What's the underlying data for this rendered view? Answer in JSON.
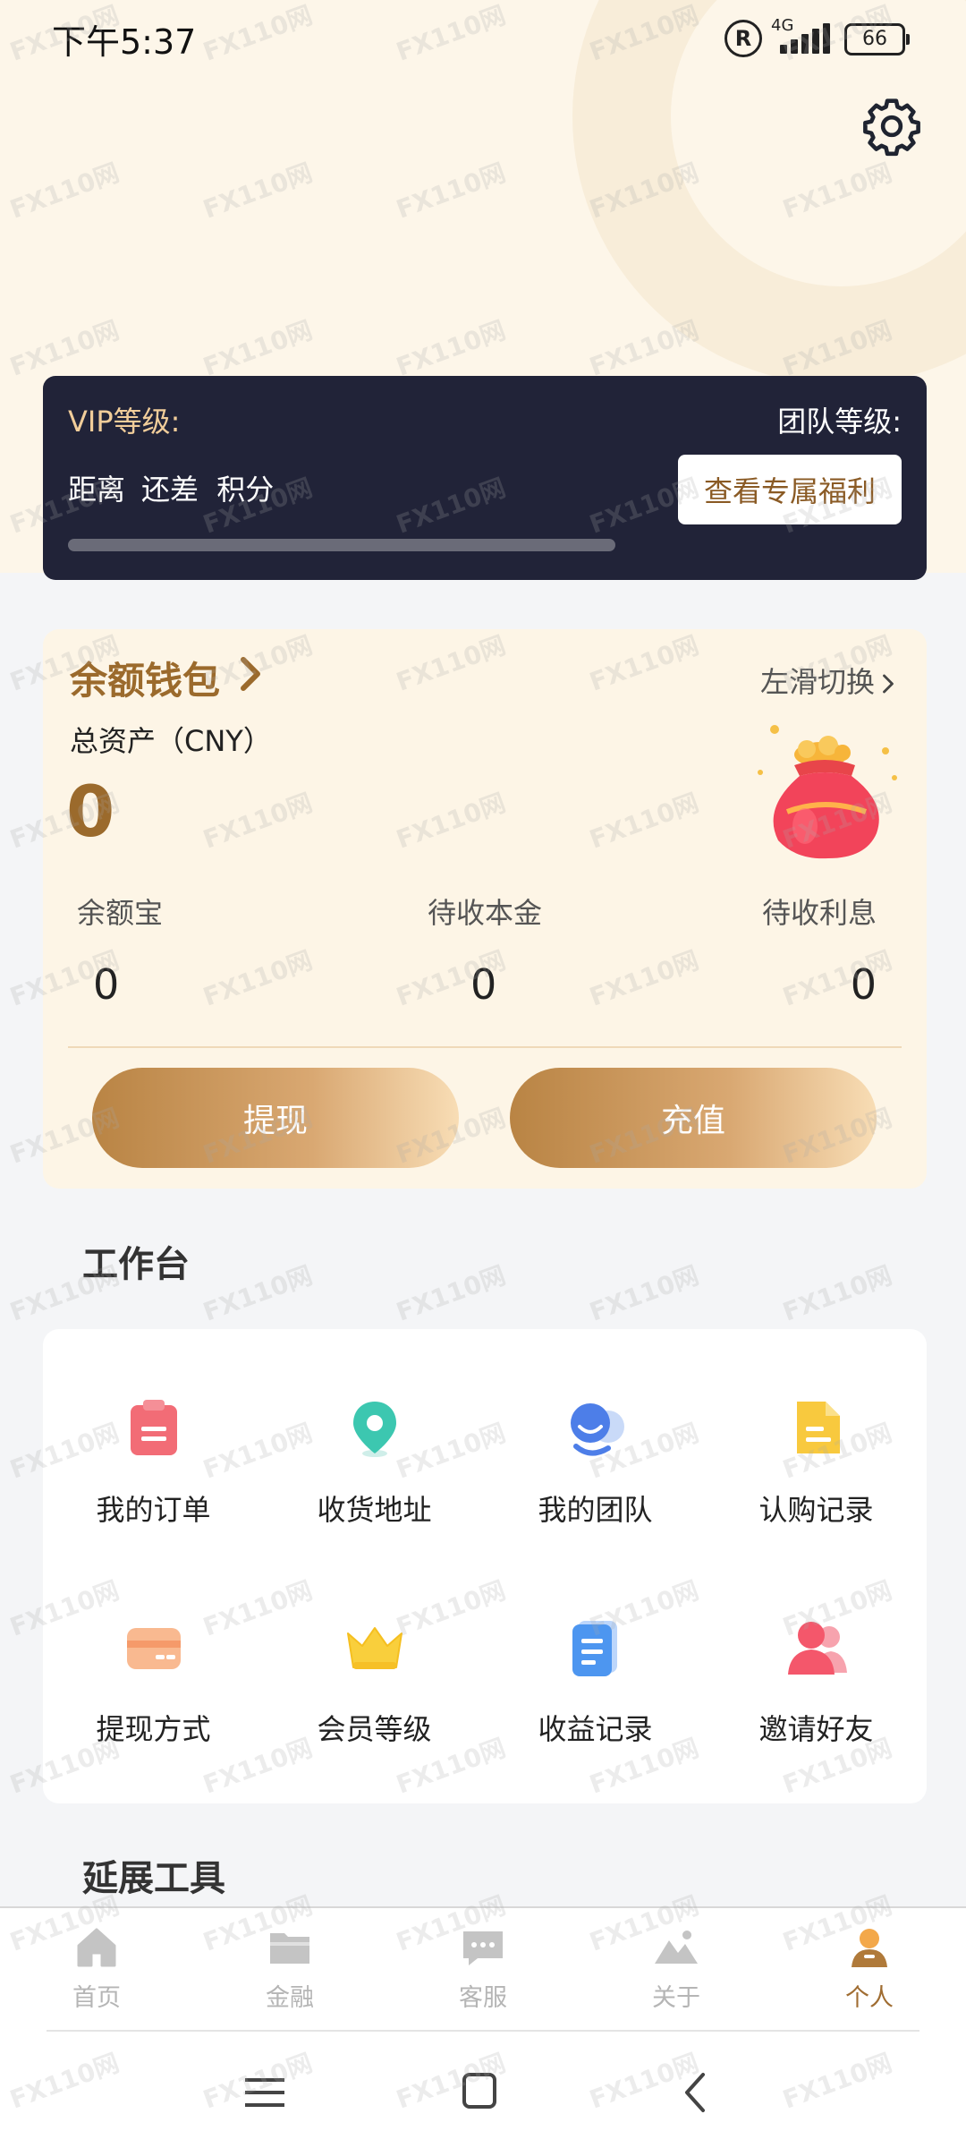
{
  "status_bar": {
    "time": "下午5:37",
    "network": "4G",
    "battery": "66"
  },
  "vip_card": {
    "vip_level_label": "VIP等级:",
    "team_level_label": "团队等级:",
    "distance_words": [
      "距离",
      "还差",
      "积分"
    ],
    "benefit_button": "查看专属福利"
  },
  "wallet": {
    "title": "余额钱包",
    "swipe_hint": "左滑切换",
    "total_assets_label": "总资产（CNY）",
    "total_assets_value": "0",
    "stats": [
      {
        "label": "余额宝",
        "value": "0"
      },
      {
        "label": "待收本金",
        "value": "0"
      },
      {
        "label": "待收利息",
        "value": "0"
      }
    ],
    "withdraw_button": "提现",
    "recharge_button": "充值"
  },
  "workbench": {
    "title": "工作台",
    "items": [
      {
        "label": "我的订单",
        "icon": "order-icon"
      },
      {
        "label": "收货地址",
        "icon": "location-pin-icon"
      },
      {
        "label": "我的团队",
        "icon": "team-icon"
      },
      {
        "label": "认购记录",
        "icon": "subscription-record-icon"
      },
      {
        "label": "提现方式",
        "icon": "card-icon"
      },
      {
        "label": "会员等级",
        "icon": "crown-icon"
      },
      {
        "label": "收益记录",
        "icon": "earnings-record-icon"
      },
      {
        "label": "邀请好友",
        "icon": "invite-friends-icon"
      }
    ]
  },
  "extension_tools": {
    "title": "延展工具"
  },
  "bottom_nav": {
    "items": [
      {
        "label": "首页",
        "icon": "home-icon"
      },
      {
        "label": "金融",
        "icon": "folder-icon"
      },
      {
        "label": "客服",
        "icon": "chat-icon"
      },
      {
        "label": "关于",
        "icon": "mountain-icon"
      },
      {
        "label": "个人",
        "icon": "user-icon",
        "active": true
      }
    ]
  },
  "watermark": "FX110网",
  "colors": {
    "accent": "#9b6a2c",
    "vip_card": "#212338",
    "wallet_bg": "#fdf5e6"
  }
}
